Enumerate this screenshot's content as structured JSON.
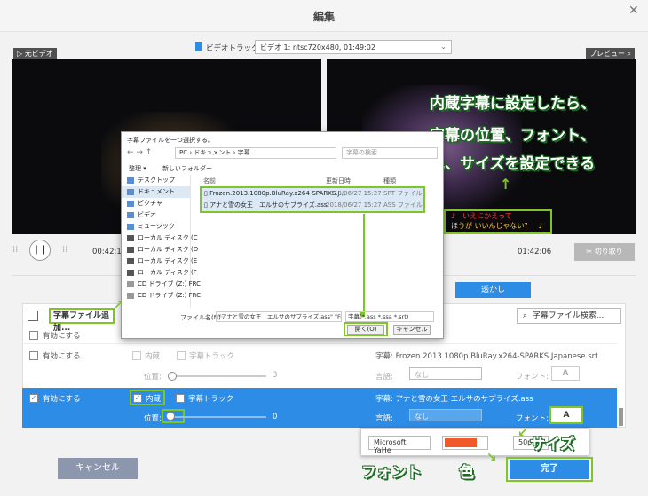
{
  "window": {
    "title": "編集"
  },
  "top": {
    "original_label": "▷ 元ビデオ",
    "preview_label": "プレビュー",
    "track_label": "ビデオトラック:",
    "track_value": "ビデオ 1: ntsc720x480, 01:49:02"
  },
  "annotations": {
    "main_line1": "内蔵字幕に設定したら、",
    "main_line2": "字幕の位置、フォント、",
    "main_line3": "色、サイズを設定できる",
    "size": "サイズ",
    "font": "フォント",
    "color": "色"
  },
  "preview_subtitle": {
    "line1": "♪　いえにかえって",
    "line2": "ほうが いいんじゃない？　♪"
  },
  "playback": {
    "time_left": "00:42:1",
    "time_right": "01:42:06",
    "cut_label": "切り取り"
  },
  "tabs": {
    "transparent": "透かし"
  },
  "subtitle_panel": {
    "add_button": "字幕ファイル追加...",
    "search_button": "字幕ファイル検索...",
    "rows": [
      {
        "enable": "有効にする"
      },
      {
        "enable": "有効にする",
        "internal": "内蔵",
        "track": "字幕トラック",
        "position": "位置:",
        "pos_value": "3",
        "file": "字幕: Frozen.2013.1080p.BluRay.x264-SPARKS.Japanese.srt",
        "lang_label": "言語:",
        "lang_value": "なし",
        "font_label": "フォント:",
        "font_btn": "A"
      },
      {
        "enable": "有効にする",
        "internal": "内蔵",
        "track": "字幕トラック",
        "position": "位置:",
        "pos_value": "0",
        "file": "字幕: アナと雪の女王 エルサのサプライズ.ass",
        "lang_label": "言語:",
        "lang_value": "なし",
        "font_label": "フォント:",
        "font_btn": "A"
      }
    ]
  },
  "font_popup": {
    "font_name": "Microsoft YaHe",
    "color": "#f05a28",
    "size": "50px"
  },
  "buttons": {
    "cancel": "キャンセル",
    "done": "完了"
  },
  "file_dialog": {
    "title": "字幕ファイルを一つ選択する。",
    "breadcrumb": "PC › ドキュメント › 字幕",
    "search_placeholder": "字幕の検索",
    "organize": "整理 ▾",
    "new_folder": "新しいフォルダー",
    "tree": [
      "デスクトップ",
      "ドキュメント",
      "ピクチャ",
      "ビデオ",
      "ミュージック",
      "ローカル ディスク (C",
      "ローカル ディスク (D",
      "ローカル ディスク (E",
      "ローカル ディスク (F",
      "CD ドライブ (Z:) FRC",
      "CD ドライブ (Z:) FRC"
    ],
    "columns": {
      "name": "名前",
      "date": "更新日時",
      "type": "種類"
    },
    "files": [
      {
        "name": "Frozen.2013.1080p.BluRay.x264-SPARKS.J...",
        "date": "2018/06/27 15:27",
        "type": "SRT ファイル"
      },
      {
        "name": "アナと雪の女王　エルサのサプライズ.ass",
        "date": "2018/06/27 15:27",
        "type": "ASS ファイル"
      }
    ],
    "filename_label": "ファイル名(N):",
    "filename_value": "\"アナと雪の女王　エルサのサプライズ.ass\" \"Frozen.",
    "filter_value": "字幕(*.ass *.ssa *.srt)",
    "open_button": "開く(O)",
    "cancel_button": "キャンセル"
  }
}
